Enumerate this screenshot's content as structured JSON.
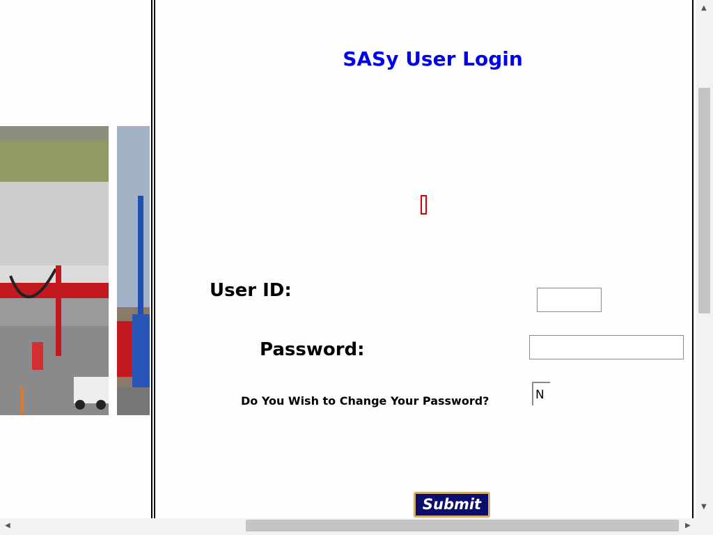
{
  "login": {
    "title": "SASy User Login",
    "user_id_label": "User ID:",
    "user_id_value": "",
    "password_label": "Password:",
    "password_value": "",
    "change_password_label": "Do You Wish to Change Your Password?",
    "change_password_value": "N",
    "submit_label": "Submit"
  },
  "colors": {
    "title": "#0000ee",
    "submit_bg": "#0d0d6d",
    "submit_border": "#d2b06a",
    "broken_image_border": "#d40000"
  },
  "icons": {
    "scroll_up": "scroll-up-arrow",
    "scroll_down": "scroll-down-arrow",
    "scroll_left": "scroll-left-arrow",
    "scroll_right": "scroll-right-arrow"
  }
}
